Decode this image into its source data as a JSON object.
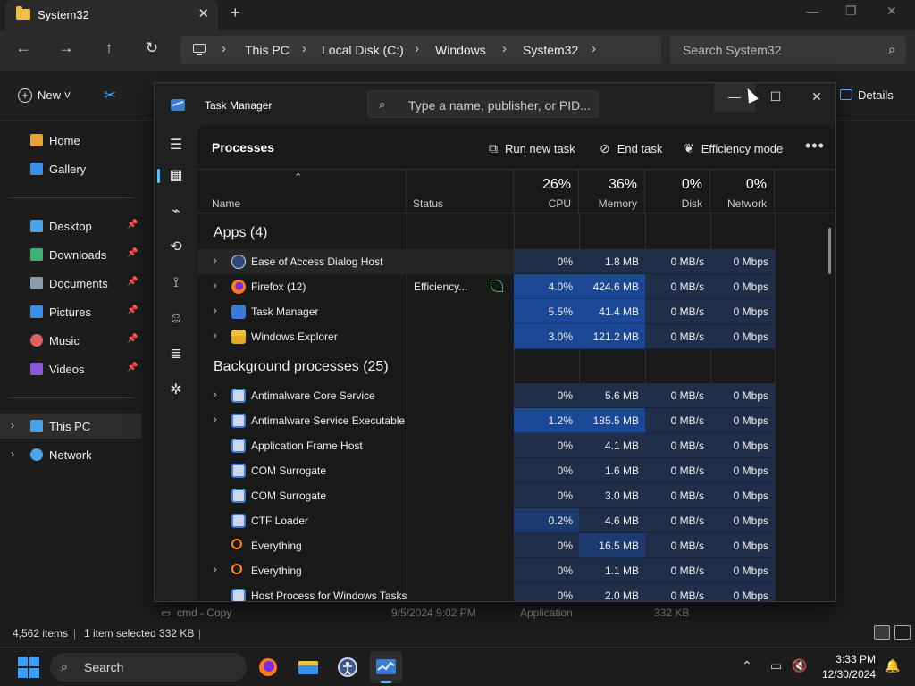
{
  "explorer": {
    "tab_title": "System32",
    "tab_close": "✕",
    "new_tab": "+",
    "window_controls": {
      "minimize": "—",
      "maximize": "❐",
      "close": "✕"
    },
    "nav": {
      "back": "←",
      "forward": "→",
      "up": "↑",
      "refresh": "↻"
    },
    "breadcrumbs": [
      "This PC",
      "Local Disk (C:)",
      "Windows",
      "System32"
    ],
    "search_placeholder": "Search System32",
    "commands": {
      "new": "New",
      "details": "Details"
    },
    "sidebar": [
      {
        "label": "Home",
        "icon": "home-icon",
        "color": "#e9a23b"
      },
      {
        "label": "Gallery",
        "icon": "gallery-icon",
        "color": "#3a8ee6"
      },
      {
        "label": "Desktop",
        "icon": "desktop-icon",
        "color": "#4aa3e8",
        "pinned": true
      },
      {
        "label": "Downloads",
        "icon": "download-icon",
        "color": "#3cb371",
        "pinned": true
      },
      {
        "label": "Documents",
        "icon": "documents-icon",
        "color": "#8a9bb0",
        "pinned": true
      },
      {
        "label": "Pictures",
        "icon": "pictures-icon",
        "color": "#3a8ee6",
        "pinned": true
      },
      {
        "label": "Music",
        "icon": "music-icon",
        "color": "#e06060",
        "pinned": true
      },
      {
        "label": "Videos",
        "icon": "videos-icon",
        "color": "#8a5ad8",
        "pinned": true
      },
      {
        "label": "This PC",
        "icon": "pc-icon",
        "color": "#4aa3e8",
        "selected": true
      },
      {
        "label": "Network",
        "icon": "network-icon",
        "color": "#4aa3e8"
      }
    ],
    "background_row": {
      "name": "cmd - Copy",
      "date": "9/5/2024 9:02 PM",
      "type": "Application",
      "size": "332 KB"
    },
    "status": {
      "items": "4,562 items",
      "selected": "1 item selected  332 KB"
    }
  },
  "task_manager": {
    "title": "Task Manager",
    "search_placeholder": "Type a name, publisher, or PID...",
    "page_title": "Processes",
    "toolbar": {
      "run_new_task": "Run new task",
      "end_task": "End task",
      "efficiency_mode": "Efficiency mode",
      "more": "•••"
    },
    "columns": {
      "name": "Name",
      "status": "Status",
      "cpu": {
        "label": "CPU",
        "pct": "26%"
      },
      "memory": {
        "label": "Memory",
        "pct": "36%"
      },
      "disk": {
        "label": "Disk",
        "pct": "0%"
      },
      "network": {
        "label": "Network",
        "pct": "0%"
      }
    },
    "groups": [
      {
        "title": "Apps (4)",
        "rows": [
          {
            "name": "Ease of Access Dialog Host",
            "icon": "ease-of-access-icon",
            "expandable": true,
            "status": "",
            "cpu": "0%",
            "memory": "1.8 MB",
            "disk": "0 MB/s",
            "network": "0 Mbps",
            "hover": true
          },
          {
            "name": "Firefox (12)",
            "icon": "firefox-icon",
            "expandable": true,
            "status": "Efficiency...",
            "efficiency_leaf": true,
            "cpu": "4.0%",
            "memory": "424.6 MB",
            "disk": "0 MB/s",
            "network": "0 Mbps"
          },
          {
            "name": "Task Manager",
            "icon": "task-manager-icon",
            "expandable": true,
            "status": "",
            "cpu": "5.5%",
            "memory": "41.4 MB",
            "disk": "0 MB/s",
            "network": "0 Mbps"
          },
          {
            "name": "Windows Explorer",
            "icon": "folder-icon",
            "expandable": true,
            "status": "",
            "cpu": "3.0%",
            "memory": "121.2 MB",
            "disk": "0 MB/s",
            "network": "0 Mbps"
          }
        ]
      },
      {
        "title": "Background processes (25)",
        "rows": [
          {
            "name": "Antimalware Core Service",
            "icon": "service-icon",
            "expandable": true,
            "status": "",
            "cpu": "0%",
            "memory": "5.6 MB",
            "disk": "0 MB/s",
            "network": "0 Mbps"
          },
          {
            "name": "Antimalware Service Executable",
            "icon": "service-icon",
            "expandable": true,
            "status": "",
            "cpu": "1.2%",
            "memory": "185.5 MB",
            "disk": "0 MB/s",
            "network": "0 Mbps"
          },
          {
            "name": "Application Frame Host",
            "icon": "service-icon",
            "expandable": false,
            "status": "",
            "cpu": "0%",
            "memory": "4.1 MB",
            "disk": "0 MB/s",
            "network": "0 Mbps"
          },
          {
            "name": "COM Surrogate",
            "icon": "service-icon",
            "expandable": false,
            "status": "",
            "cpu": "0%",
            "memory": "1.6 MB",
            "disk": "0 MB/s",
            "network": "0 Mbps"
          },
          {
            "name": "COM Surrogate",
            "icon": "service-icon",
            "expandable": false,
            "status": "",
            "cpu": "0%",
            "memory": "3.0 MB",
            "disk": "0 MB/s",
            "network": "0 Mbps"
          },
          {
            "name": "CTF Loader",
            "icon": "service-icon",
            "expandable": false,
            "status": "",
            "cpu": "0.2%",
            "memory": "4.6 MB",
            "disk": "0 MB/s",
            "network": "0 Mbps"
          },
          {
            "name": "Everything",
            "icon": "everything-icon",
            "expandable": false,
            "status": "",
            "cpu": "0%",
            "memory": "16.5 MB",
            "disk": "0 MB/s",
            "network": "0 Mbps"
          },
          {
            "name": "Everything",
            "icon": "everything-icon",
            "expandable": true,
            "status": "",
            "cpu": "0%",
            "memory": "1.1 MB",
            "disk": "0 MB/s",
            "network": "0 Mbps"
          },
          {
            "name": "Host Process for Windows Tasks",
            "icon": "service-icon",
            "expandable": false,
            "status": "",
            "cpu": "0%",
            "memory": "2.0 MB",
            "disk": "0 MB/s",
            "network": "0 Mbps"
          }
        ]
      }
    ],
    "heat_colors": {
      "low": "#1f2f4a",
      "mid": "#1d3a6e",
      "high": "#1a4796"
    }
  },
  "taskbar": {
    "search_placeholder": "Search",
    "apps": [
      "firefox-icon",
      "file-explorer-icon",
      "ease-of-access-icon",
      "task-manager-icon"
    ],
    "clock": {
      "time": "3:33 PM",
      "date": "12/30/2024"
    }
  }
}
